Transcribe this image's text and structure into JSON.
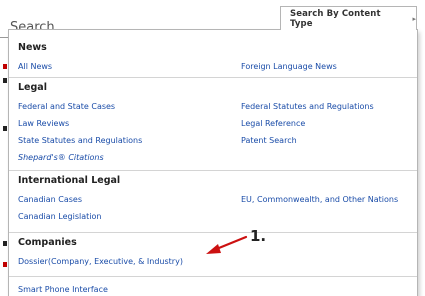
{
  "page_title": "Search",
  "menu_button": {
    "label": "Search By Content Type",
    "arrow": "▸"
  },
  "sections": {
    "news": {
      "heading": "News",
      "links": [
        "All News",
        "Foreign Language News"
      ]
    },
    "legal": {
      "heading": "Legal",
      "links": [
        "Federal and State Cases",
        "Federal Statutes and Regulations",
        "Law Reviews",
        "Legal Reference",
        "State Statutes and Regulations",
        "Patent Search",
        "Shepard's® Citations"
      ]
    },
    "international_legal": {
      "heading": "International Legal",
      "links": [
        "Canadian Cases",
        "EU, Commonwealth, and Other Nations",
        "Canadian Legislation"
      ]
    },
    "companies": {
      "heading": "Companies",
      "links": [
        "Dossier(Company, Executive, & Industry)"
      ]
    },
    "other": {
      "links": [
        "Smart Phone Interface"
      ]
    }
  },
  "annotation": {
    "label": "1.",
    "arrow_color": "#cc1111"
  }
}
